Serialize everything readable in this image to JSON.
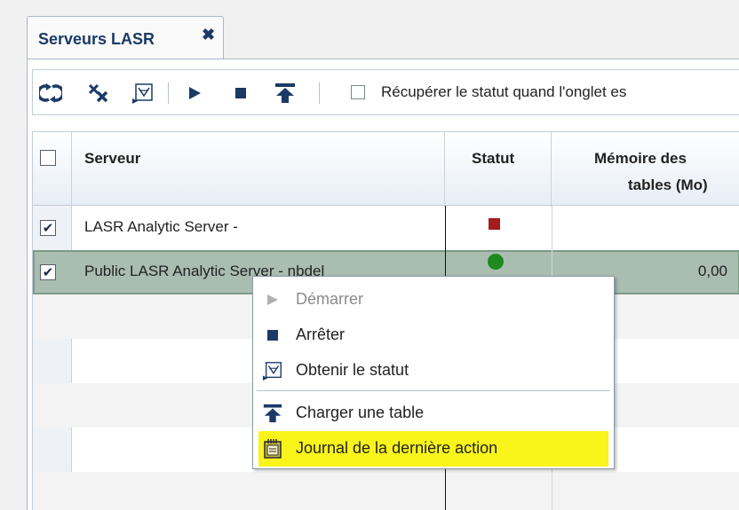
{
  "tab": {
    "title": "Serveurs LASR",
    "close": "✖"
  },
  "toolbar": {
    "checkbox_label": "Récupérer le statut quand l'onglet es"
  },
  "table": {
    "headers": {
      "select_all": "",
      "server": "Serveur",
      "status": "Statut",
      "memory_line1": "Mémoire des",
      "memory_line2": "tables (Mo)"
    },
    "rows": [
      {
        "checked": "✔",
        "server": "LASR Analytic Server -",
        "status": "stopped",
        "memory": ""
      },
      {
        "checked": "✔",
        "server": "Public LASR Analytic Server - nbdel",
        "status": "running",
        "memory": "0,00"
      }
    ]
  },
  "context_menu": {
    "items": [
      {
        "label": "Démarrer",
        "disabled": true
      },
      {
        "label": "Arrêter"
      },
      {
        "label": "Obtenir le statut"
      },
      {
        "label": "Charger une table"
      },
      {
        "label": "Journal de la dernière action",
        "highlighted": true
      }
    ]
  },
  "colors": {
    "status_stopped": "#a51c1c",
    "status_running": "#1e8a1e",
    "highlight": "#f9f51a",
    "selected_row": "#a9bdb1",
    "icon_blue": "#1b3a66"
  }
}
